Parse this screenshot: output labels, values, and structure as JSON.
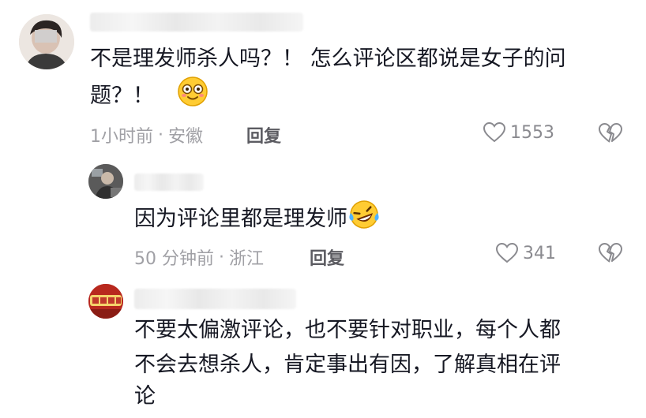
{
  "comments": [
    {
      "text_line1": "不是理发师杀人吗？！ 怎么评论区都说是女子的问",
      "text_line2": "题？！",
      "emoji": "smiling-face-with-wide-eyes",
      "time": "1小时前",
      "location": "安徽",
      "reply_label": "回复",
      "likes": "1553"
    },
    {
      "text_line1": "因为评论里都是理发师",
      "emoji": "rolling-on-floor-laughing",
      "time": "50 分钟前",
      "location": "浙江",
      "reply_label": "回复",
      "likes": "341"
    },
    {
      "text_line1": "不要太偏激评论，也不要针对职业，每个人都",
      "text_line2": "不会去想杀人，肯定事出有因，了解真相在评",
      "text_line3": "论"
    }
  ],
  "separator": "·",
  "colors": {
    "text": "#161823",
    "meta": "#a0a0a5",
    "icon": "#8a8a8f"
  }
}
